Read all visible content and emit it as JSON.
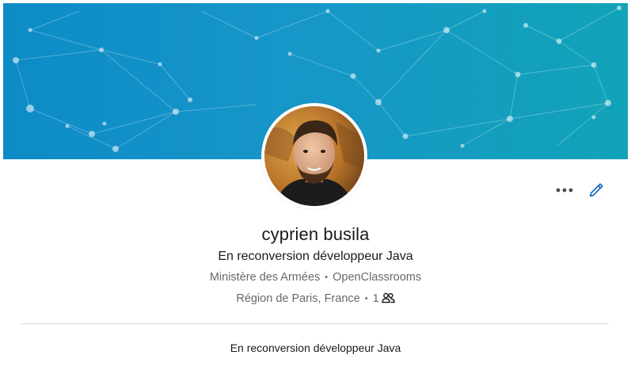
{
  "profile": {
    "name": "cyprien busila",
    "headline": "En reconversion développeur Java",
    "companies": [
      "Ministère des Armées",
      "OpenClassrooms"
    ],
    "separator": "•",
    "location": "Région de Paris, France",
    "connections": "1",
    "summary": "En reconversion développeur Java"
  },
  "actions": {
    "more_icon": "more-horizontal-icon",
    "edit_icon": "pencil-icon"
  },
  "colors": {
    "banner_start": "#0d8bc6",
    "banner_end": "#11a3b8",
    "accent": "#0a66c2",
    "secondary_text": "#666666"
  }
}
